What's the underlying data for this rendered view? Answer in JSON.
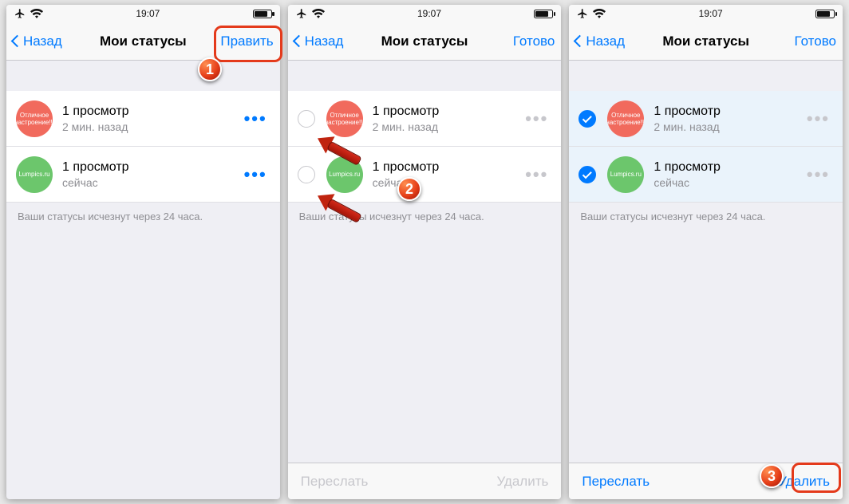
{
  "statusbar": {
    "time": "19:07"
  },
  "screens": [
    {
      "nav": {
        "back": "Назад",
        "title": "Мои статусы",
        "right": "Править"
      },
      "rows": [
        {
          "thumb_color": "red",
          "thumb_text": "Отличное настроение!!!",
          "title": "1 просмотр",
          "sub": "2 мин. назад",
          "show_selector": false,
          "selected": false,
          "more_disabled": false
        },
        {
          "thumb_color": "green",
          "thumb_text": "Lumpics.ru",
          "title": "1 просмотр",
          "sub": "сейчас",
          "show_selector": false,
          "selected": false,
          "more_disabled": false
        }
      ],
      "footnote": "Ваши статусы исчезнут через 24 часа.",
      "toolbar": null
    },
    {
      "nav": {
        "back": "Назад",
        "title": "Мои статусы",
        "right": "Готово"
      },
      "rows": [
        {
          "thumb_color": "red",
          "thumb_text": "Отличное настроение!!!",
          "title": "1 просмотр",
          "sub": "2 мин. назад",
          "show_selector": true,
          "selected": false,
          "more_disabled": true
        },
        {
          "thumb_color": "green",
          "thumb_text": "Lumpics.ru",
          "title": "1 просмотр",
          "sub": "сейчас",
          "show_selector": true,
          "selected": false,
          "more_disabled": true
        }
      ],
      "footnote": "Ваши статусы исчезнут через 24 часа.",
      "toolbar": {
        "left": "Переслать",
        "right": "Удалить",
        "disabled": true
      }
    },
    {
      "nav": {
        "back": "Назад",
        "title": "Мои статусы",
        "right": "Готово"
      },
      "rows": [
        {
          "thumb_color": "red",
          "thumb_text": "Отличное настроение!!!",
          "title": "1 просмотр",
          "sub": "2 мин. назад",
          "show_selector": true,
          "selected": true,
          "more_disabled": true
        },
        {
          "thumb_color": "green",
          "thumb_text": "Lumpics.ru",
          "title": "1 просмотр",
          "sub": "сейчас",
          "show_selector": true,
          "selected": true,
          "more_disabled": true
        }
      ],
      "footnote": "Ваши статусы исчезнут через 24 часа.",
      "toolbar": {
        "left": "Переслать",
        "right": "Удалить",
        "disabled": false
      }
    }
  ],
  "annotations": {
    "badge1": "1",
    "badge2": "2",
    "badge3": "3"
  }
}
